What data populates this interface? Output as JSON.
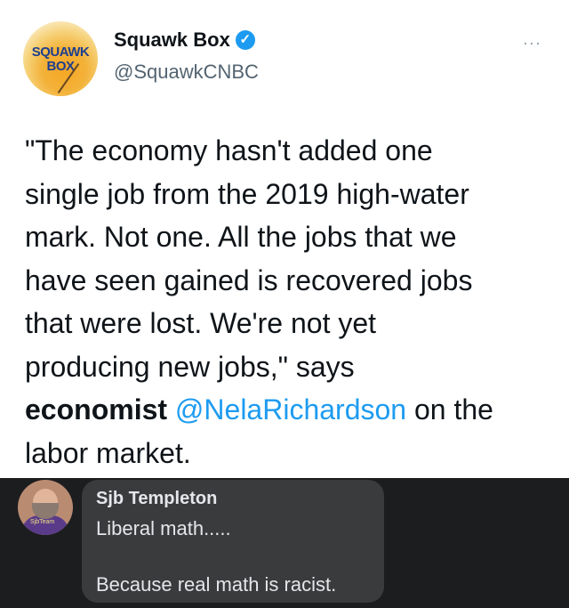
{
  "tweet": {
    "avatar_logo": [
      "SQUAWK",
      "BOX"
    ],
    "display_name": "Squawk Box",
    "verified_icon": "verified-badge-icon",
    "handle": "@SquawkCNBC",
    "more_icon": "···",
    "text_lines": [
      "\"The economy hasn't added one",
      "single job from the 2019 high-water",
      "mark. Not one. All the jobs that we",
      "have seen gained is recovered jobs",
      "that were lost. We're not yet",
      "producing new jobs,\" says"
    ],
    "line7_bold": "economist",
    "line7_mention": "@NelaRichardson",
    "line7_rest": "on the",
    "line8": "labor market."
  },
  "comment": {
    "author": "Sjb Templeton",
    "line1": "Liberal math.....",
    "line2": "Because real math is racist.",
    "avatar_shirt_text": "SjbTeam"
  },
  "colors": {
    "mention": "#1d9bf0",
    "verified": "#1d9bf0",
    "comment_bg": "#1c1d1f",
    "bubble_bg": "#3a3b3c"
  }
}
